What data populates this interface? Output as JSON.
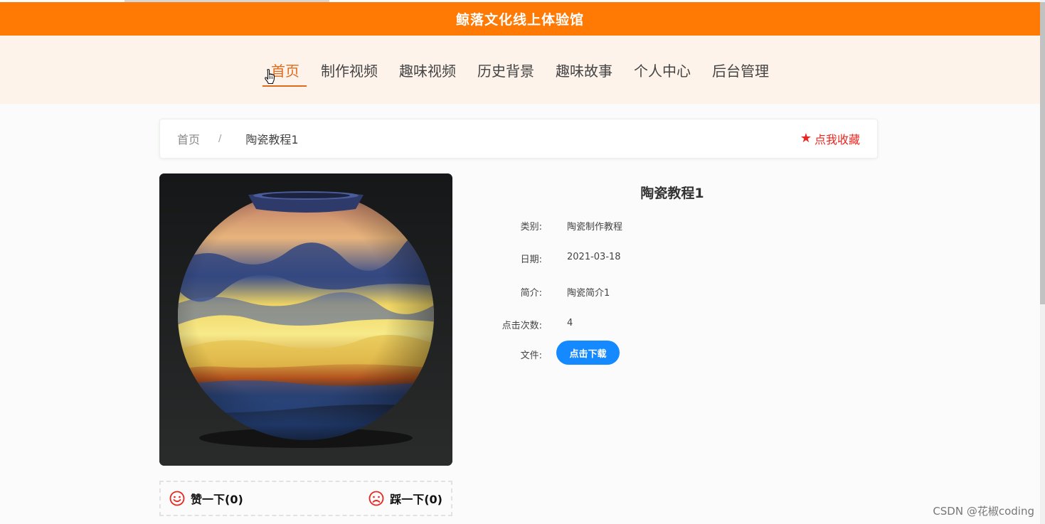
{
  "site": {
    "title": "鲸落文化线上体验馆"
  },
  "nav": {
    "items": [
      {
        "label": "首页"
      },
      {
        "label": "制作视频"
      },
      {
        "label": "趣味视频"
      },
      {
        "label": "历史背景"
      },
      {
        "label": "趣味故事"
      },
      {
        "label": "个人中心"
      },
      {
        "label": "后台管理"
      }
    ],
    "active_index": 0
  },
  "breadcrumb": {
    "home": "首页",
    "separator": "/",
    "current": "陶瓷教程1"
  },
  "favorite": {
    "label": "点我收藏",
    "icon": "star-icon"
  },
  "detail": {
    "title": "陶瓷教程1",
    "fields": [
      {
        "label": "类别:",
        "value": "陶瓷制作教程"
      },
      {
        "label": "日期:",
        "value": "2021-03-18"
      },
      {
        "label": "简介:",
        "value": "陶瓷简介1"
      },
      {
        "label": "点击次数:",
        "value": "4"
      }
    ],
    "file_label": "文件:",
    "download_label": "点击下载"
  },
  "votes": {
    "like_label": "赞一下(0)",
    "dislike_label": "踩一下(0)"
  },
  "watermark": "CSDN @花椒coding",
  "colors": {
    "brand": "#ff7a05",
    "nav_bg": "#fdf3ea",
    "active": "#e06b1a",
    "favorite": "#e8261f",
    "button": "#1589ff"
  }
}
